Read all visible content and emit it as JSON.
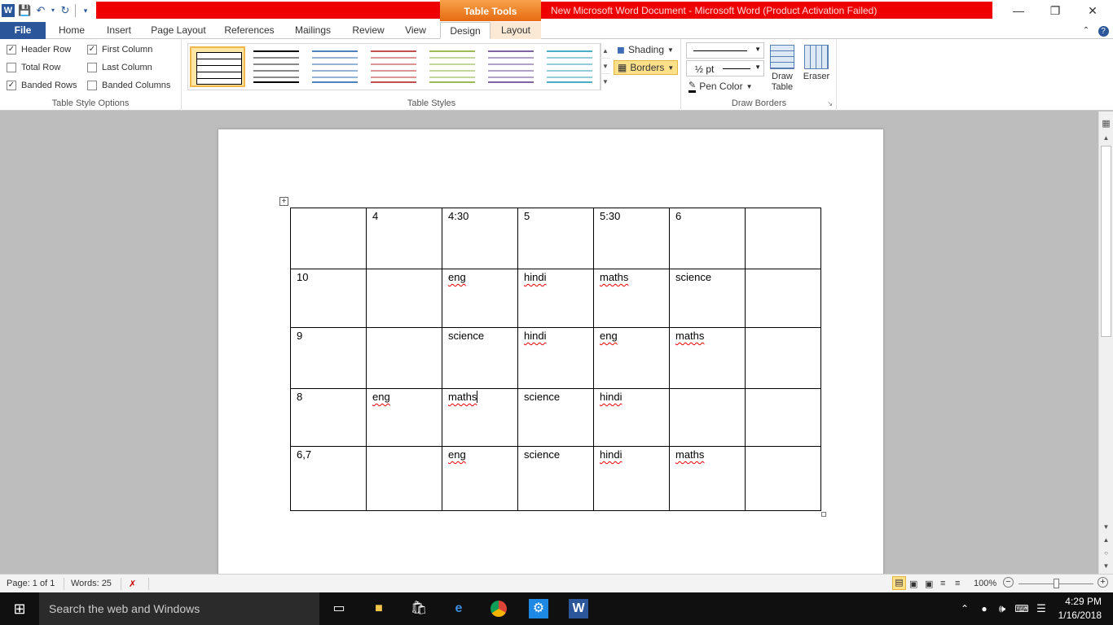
{
  "titlebar": {
    "context_tab": "Table Tools",
    "document_title": "New Microsoft Word Document  -  Microsoft Word (Product Activation Failed)"
  },
  "tabs": [
    {
      "label": "File"
    },
    {
      "label": "Home"
    },
    {
      "label": "Insert"
    },
    {
      "label": "Page Layout"
    },
    {
      "label": "References"
    },
    {
      "label": "Mailings"
    },
    {
      "label": "Review"
    },
    {
      "label": "View"
    },
    {
      "label": "Design"
    },
    {
      "label": "Layout"
    }
  ],
  "table_style_options": {
    "group_label": "Table Style Options",
    "header_row": {
      "label": "Header Row",
      "checked": true
    },
    "total_row": {
      "label": "Total Row",
      "checked": false
    },
    "banded_rows": {
      "label": "Banded Rows",
      "checked": true
    },
    "first_column": {
      "label": "First Column",
      "checked": true
    },
    "last_column": {
      "label": "Last Column",
      "checked": false
    },
    "banded_columns": {
      "label": "Banded Columns",
      "checked": false
    }
  },
  "table_styles": {
    "group_label": "Table Styles",
    "shading_label": "Shading",
    "borders_label": "Borders",
    "swatch_colors": [
      "#000000",
      "#555555",
      "#4f81bd",
      "#c0504d",
      "#9bbb59",
      "#8064a2",
      "#4bacc6"
    ]
  },
  "draw_borders": {
    "group_label": "Draw Borders",
    "line_weight": "½ pt",
    "pen_color_label": "Pen Color",
    "draw_table_label": "Draw Table",
    "eraser_label": "Eraser"
  },
  "document": {
    "table": [
      [
        {
          "t": ""
        },
        {
          "t": "4"
        },
        {
          "t": "4:30"
        },
        {
          "t": "5"
        },
        {
          "t": "5:30"
        },
        {
          "t": "6"
        },
        {
          "t": ""
        }
      ],
      [
        {
          "t": "10"
        },
        {
          "t": ""
        },
        {
          "t": "eng",
          "sq": true
        },
        {
          "t": "hindi",
          "sq": true
        },
        {
          "t": "maths",
          "sq": true
        },
        {
          "t": "science"
        },
        {
          "t": ""
        }
      ],
      [
        {
          "t": "9"
        },
        {
          "t": ""
        },
        {
          "t": "science"
        },
        {
          "t": "hindi",
          "sq": true
        },
        {
          "t": "eng",
          "sq": true
        },
        {
          "t": "maths",
          "sq": true
        },
        {
          "t": ""
        }
      ],
      [
        {
          "t": "8"
        },
        {
          "t": "eng",
          "sq": true
        },
        {
          "t": "maths",
          "sq": true,
          "caret": true
        },
        {
          "t": "science"
        },
        {
          "t": "hindi",
          "sq": true
        },
        {
          "t": ""
        },
        {
          "t": ""
        }
      ],
      [
        {
          "t": "6,7"
        },
        {
          "t": ""
        },
        {
          "t": "eng",
          "sq": true
        },
        {
          "t": "science"
        },
        {
          "t": "hindi",
          "sq": true
        },
        {
          "t": "maths",
          "sq": true
        },
        {
          "t": ""
        }
      ]
    ]
  },
  "statusbar": {
    "page": "Page: 1 of 1",
    "words": "Words: 25",
    "zoom": "100%",
    "zoom_level": 1.0
  },
  "taskbar": {
    "search_placeholder": "Search the web and Windows",
    "time": "4:29 PM",
    "date": "1/16/2018"
  }
}
